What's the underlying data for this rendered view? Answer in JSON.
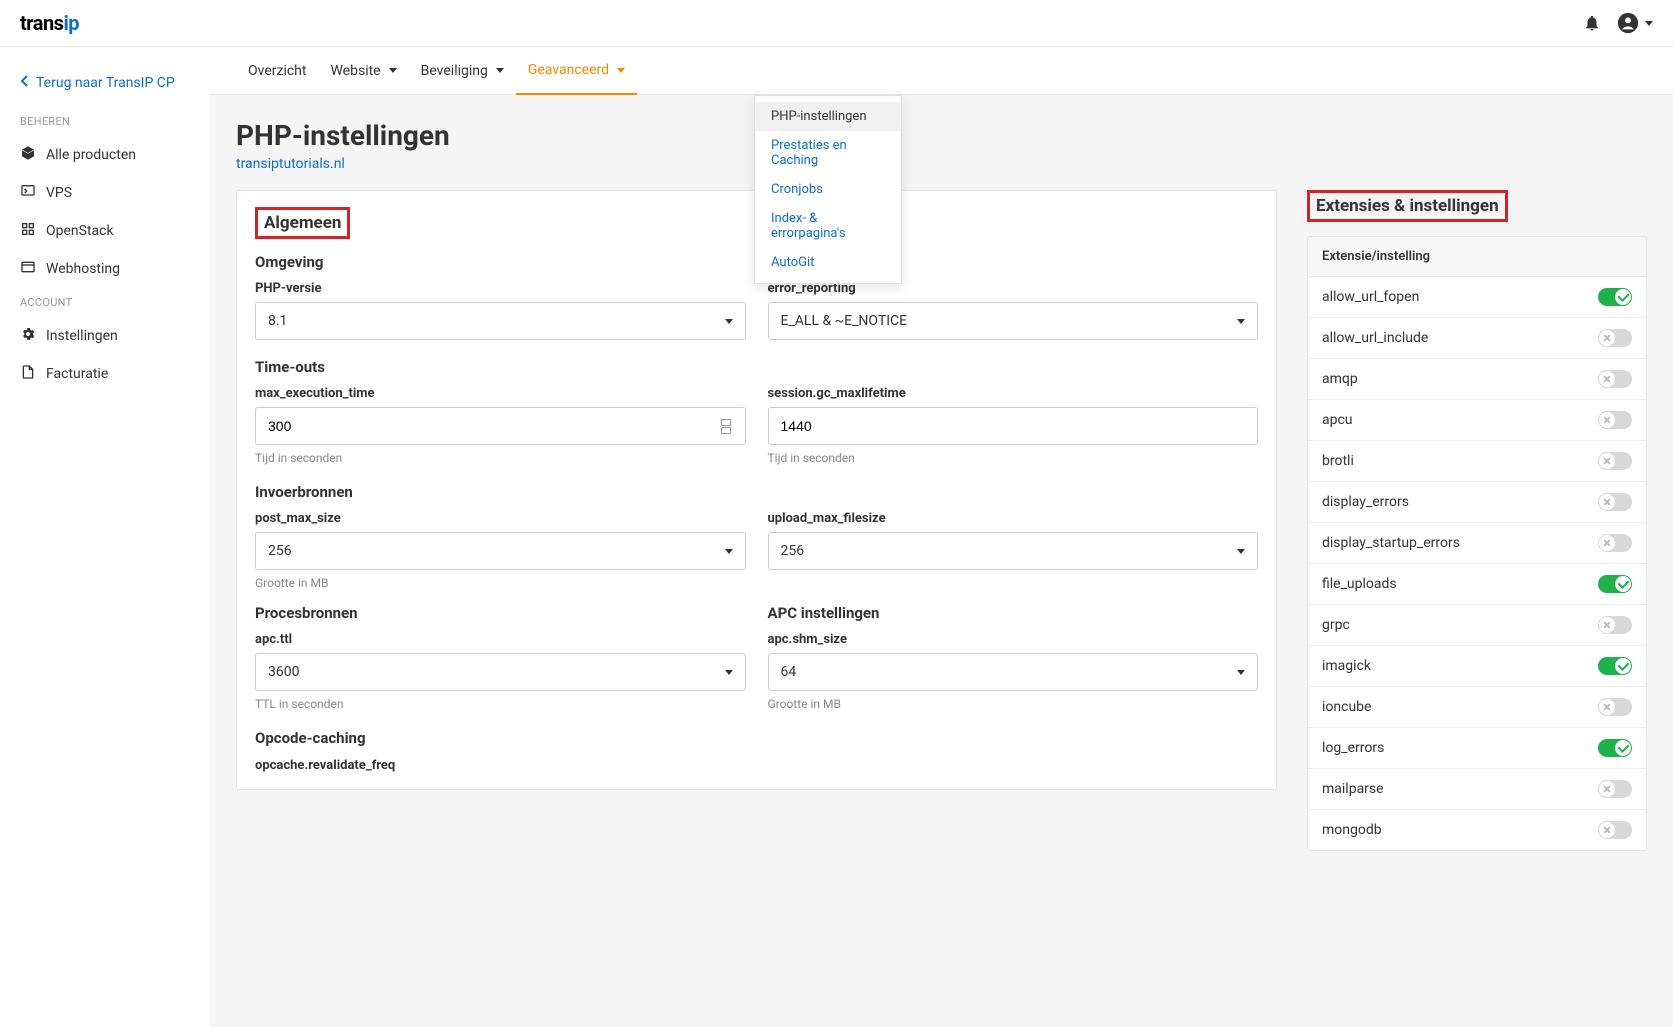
{
  "header": {
    "logo_part1": "trans",
    "logo_part2": "ip"
  },
  "sidebar": {
    "back_label": "Terug naar TransIP CP",
    "sections": [
      {
        "heading": "BEHEREN",
        "items": [
          {
            "label": "Alle producten"
          },
          {
            "label": "VPS"
          },
          {
            "label": "OpenStack"
          },
          {
            "label": "Webhosting"
          }
        ]
      },
      {
        "heading": "ACCOUNT",
        "items": [
          {
            "label": "Instellingen"
          },
          {
            "label": "Facturatie"
          }
        ]
      }
    ]
  },
  "tabs": {
    "items": [
      {
        "label": "Overzicht",
        "caret": false
      },
      {
        "label": "Website",
        "caret": true
      },
      {
        "label": "Beveiliging",
        "caret": true
      },
      {
        "label": "Geavanceerd",
        "caret": true,
        "active": true
      }
    ],
    "dropdown": [
      {
        "label": "PHP-instellingen",
        "active": true
      },
      {
        "label": "Prestaties en Caching"
      },
      {
        "label": "Cronjobs"
      },
      {
        "label": "Index- & errorpagina's"
      },
      {
        "label": "AutoGit"
      }
    ]
  },
  "page": {
    "title": "PHP-instellingen",
    "subtitle": "transiptutorials.nl"
  },
  "general": {
    "heading": "Algemeen",
    "env": {
      "title": "Omgeving",
      "php_version": {
        "label": "PHP-versie",
        "value": "8.1"
      },
      "error_reporting": {
        "label": "error_reporting",
        "value": "E_ALL & ~E_NOTICE"
      }
    },
    "timeouts": {
      "title": "Time-outs",
      "max_execution_time": {
        "label": "max_execution_time",
        "value": "300",
        "help": "Tijd in seconden"
      },
      "session_gc": {
        "label": "session.gc_maxlifetime",
        "value": "1440",
        "help": "Tijd in seconden"
      }
    },
    "input": {
      "title": "Invoerbronnen",
      "post_max_size": {
        "label": "post_max_size",
        "value": "256",
        "help": "Grootte in MB"
      },
      "upload_max_filesize": {
        "label": "upload_max_filesize",
        "value": "256"
      }
    },
    "process": {
      "title": "Procesbronnen",
      "apc_ttl": {
        "label": "apc.ttl",
        "value": "3600",
        "help": "TTL in seconden"
      }
    },
    "apc": {
      "title": "APC instellingen",
      "shm_size": {
        "label": "apc.shm_size",
        "value": "64",
        "help": "Grootte in MB"
      }
    },
    "opcode": {
      "title": "Opcode-caching",
      "revalidate": {
        "label": "opcache.revalidate_freq"
      }
    }
  },
  "extensions": {
    "heading": "Extensies & instellingen",
    "column_header": "Extensie/instelling",
    "rows": [
      {
        "name": "allow_url_fopen",
        "on": true
      },
      {
        "name": "allow_url_include",
        "on": false
      },
      {
        "name": "amqp",
        "on": false
      },
      {
        "name": "apcu",
        "on": false
      },
      {
        "name": "brotli",
        "on": false
      },
      {
        "name": "display_errors",
        "on": false
      },
      {
        "name": "display_startup_errors",
        "on": false
      },
      {
        "name": "file_uploads",
        "on": true
      },
      {
        "name": "grpc",
        "on": false
      },
      {
        "name": "imagick",
        "on": true
      },
      {
        "name": "ioncube",
        "on": false
      },
      {
        "name": "log_errors",
        "on": true
      },
      {
        "name": "mailparse",
        "on": false
      },
      {
        "name": "mongodb",
        "on": false
      }
    ]
  }
}
